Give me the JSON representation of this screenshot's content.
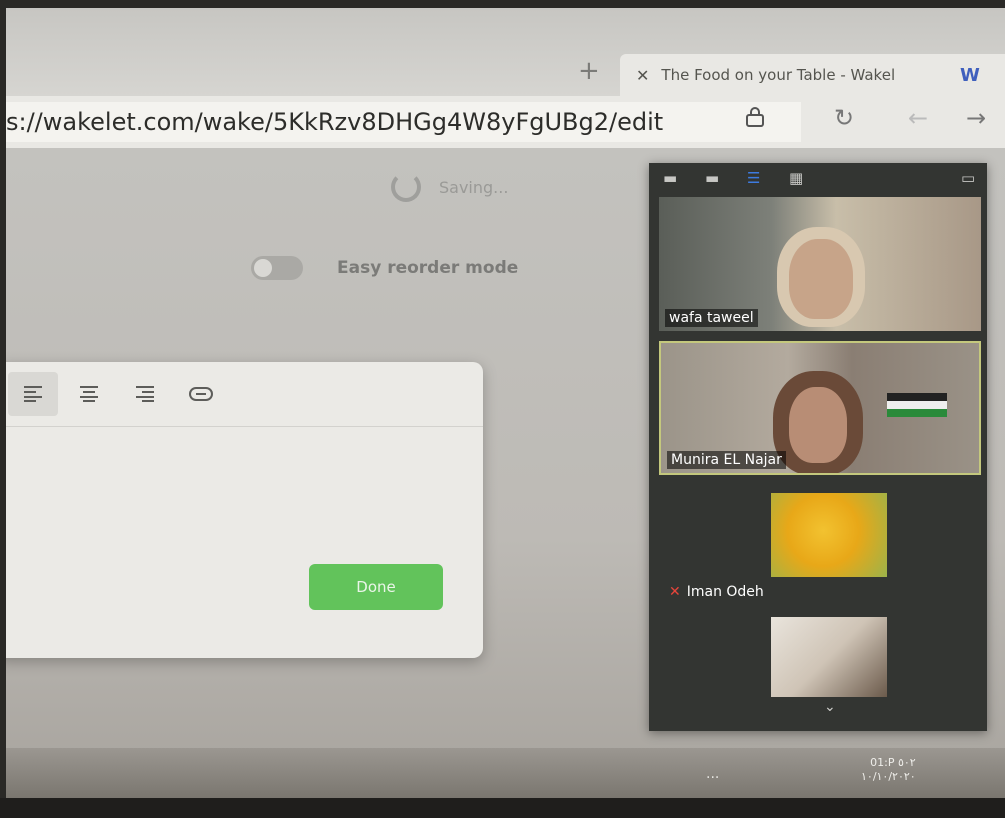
{
  "browser": {
    "new_tab_glyph": "+",
    "tab": {
      "close_glyph": "✕",
      "title": "The Food on your Table - Wakel",
      "favicon_letter": "W"
    },
    "address": {
      "url": "s://wakelet.com/wake/5KkRzv8DHGg4W8yFgUBg2/edit",
      "lock_icon": "🔒",
      "reload_icon": "↻",
      "back_icon": "←",
      "forward_icon": "→"
    }
  },
  "page": {
    "saving_label": "Saving...",
    "easy_reorder_label": "Easy reorder mode",
    "editor": {
      "toolbar": [
        "≡",
        "≡",
        "≡",
        "⊖"
      ],
      "done_label": "Done"
    }
  },
  "zoom": {
    "participants": [
      {
        "name": "wafa taweel"
      },
      {
        "name": "Munira EL Najar"
      },
      {
        "name": "Iman Odeh",
        "muted": true
      },
      {
        "name": ""
      }
    ],
    "scroll_icon": "⌄"
  },
  "taskbar": {
    "dots": "...",
    "time": "01:P ٥٠٢",
    "date": "١٠/١٠/٢٠٢٠"
  }
}
